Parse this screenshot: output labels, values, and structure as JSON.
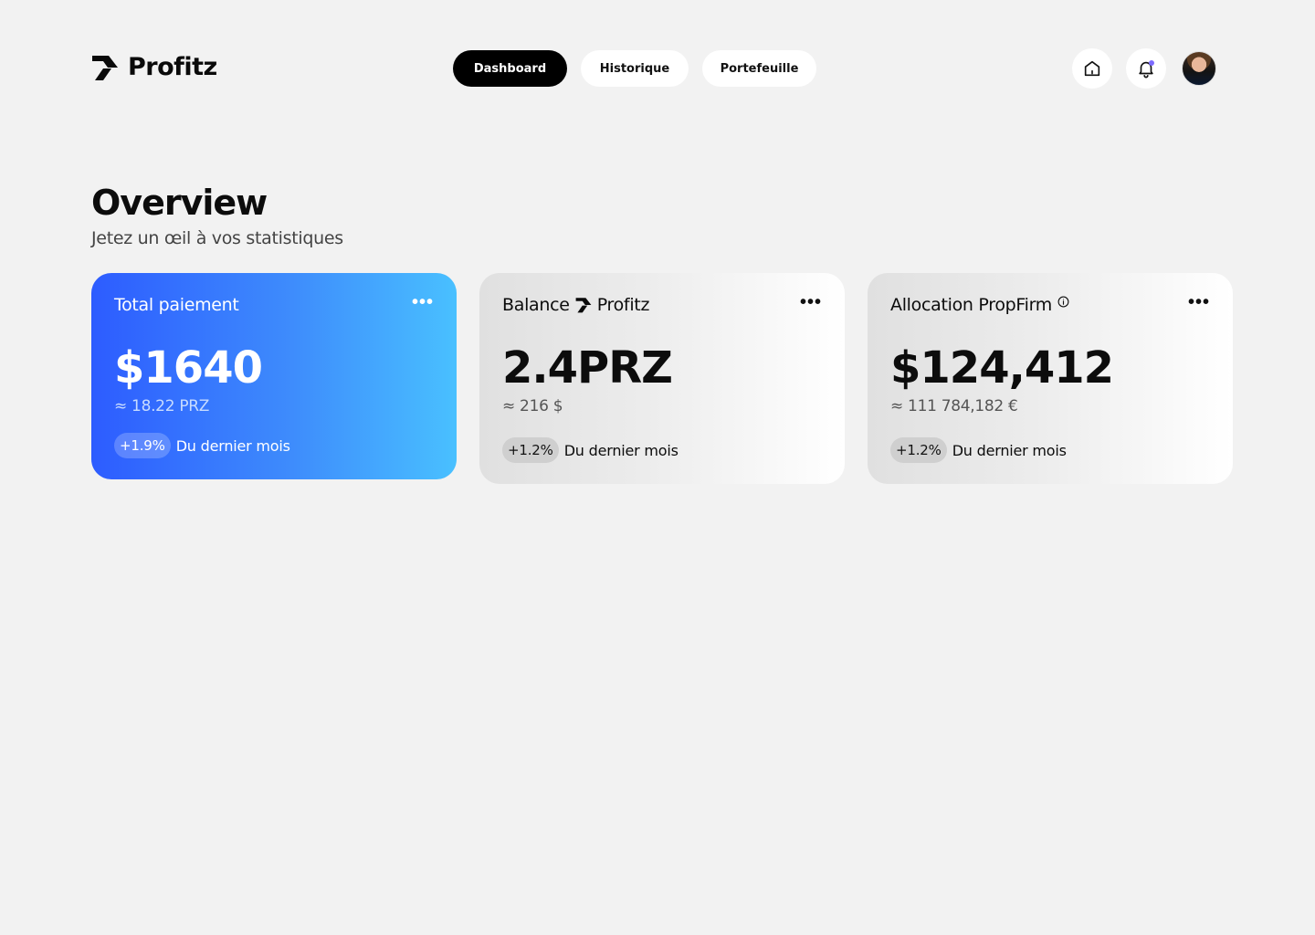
{
  "app": {
    "name": "Profitz"
  },
  "nav": {
    "items": [
      {
        "label": "Dashboard",
        "active": true
      },
      {
        "label": "Historique",
        "active": false
      },
      {
        "label": "Portefeuille",
        "active": false
      }
    ]
  },
  "header_icons": [
    "home-icon",
    "bell-icon",
    "avatar"
  ],
  "overview": {
    "title": "Overview",
    "subtitle": "Jetez un œil à vos statistiques"
  },
  "cards": [
    {
      "title": "Total paiement",
      "value": "$1640",
      "sub": "≈ 18.22 PRZ",
      "change": "+1.9%",
      "change_label": "Du dernier mois"
    },
    {
      "title": "Balance",
      "brand": "Profitz",
      "value": "2.4PRZ",
      "sub": "≈ 216 $",
      "change": "+1.2%",
      "change_label": "Du dernier mois"
    },
    {
      "title": "Allocation PropFirm",
      "value": "$124,412",
      "sub": "≈ 111 784,182 €",
      "change": "+1.2%",
      "change_label": "Du dernier mois"
    }
  ],
  "more_label": "•••",
  "colors": {
    "background": "#f2f2f2",
    "accent_blue_start": "#2d5cff",
    "accent_blue_end": "#49c0ff",
    "notification_dot": "#7d6bff"
  }
}
